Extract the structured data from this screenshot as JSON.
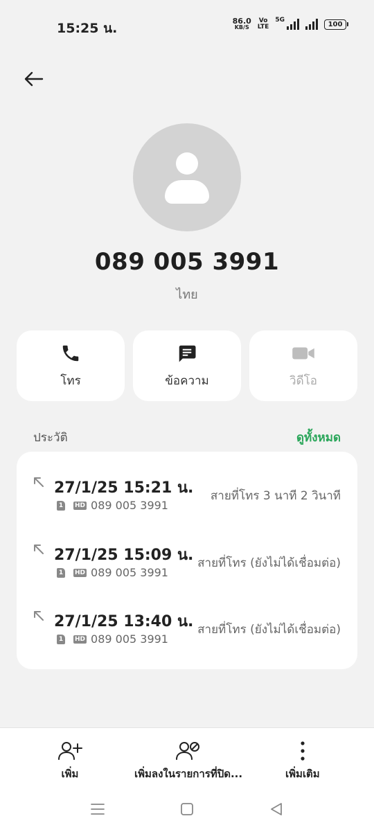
{
  "status_bar": {
    "time": "15:25 น.",
    "net_speed_value": "86.0",
    "net_speed_unit": "KB/S",
    "volte_top": "Vo",
    "volte_bottom": "LTE",
    "network_type": "5G",
    "battery": "100",
    "icons": [
      "signal-bars-icon",
      "signal-bars-icon",
      "battery-icon"
    ]
  },
  "header": {
    "back_icon": "arrow-left-icon"
  },
  "contact": {
    "avatar_icon": "person-icon",
    "number": "089 005 3991",
    "region": "ไทย"
  },
  "actions": [
    {
      "label": "โทร",
      "icon": "phone-icon",
      "enabled": true
    },
    {
      "label": "ข้อความ",
      "icon": "message-icon",
      "enabled": true
    },
    {
      "label": "วิดีโอ",
      "icon": "video-camera-icon",
      "enabled": false
    }
  ],
  "history": {
    "title": "ประวัติ",
    "view_all": "ดูทั้งหมด",
    "calls": [
      {
        "datetime": "27/1/25 15:21 น.",
        "sim": "1",
        "hd": "HD",
        "number": "089 005 3991",
        "status": "สายที่โทร  3 นาที 2 วินาที",
        "icon": "outgoing-call-icon"
      },
      {
        "datetime": "27/1/25 15:09 น.",
        "sim": "1",
        "hd": "HD",
        "number": "089 005 3991",
        "status": "สายที่โทร (ยังไม่ได้เชื่อมต่อ)",
        "icon": "outgoing-call-icon"
      },
      {
        "datetime": "27/1/25 13:40 น.",
        "sim": "1",
        "hd": "HD",
        "number": "089 005 3991",
        "status": "สายที่โทร (ยังไม่ได้เชื่อมต่อ)",
        "icon": "outgoing-call-icon"
      }
    ]
  },
  "bottom_actions": [
    {
      "label": "เพิ่ม",
      "icon": "add-person-icon"
    },
    {
      "label": "เพิ่มลงในรายการที่ปิด...",
      "icon": "block-person-icon"
    },
    {
      "label": "เพิ่มเติม",
      "icon": "more-vertical-icon"
    }
  ],
  "nav": {
    "icons": [
      "menu-icon",
      "home-icon",
      "back-icon"
    ]
  },
  "colors": {
    "accent": "#2aa65a",
    "background": "#f2f2f2",
    "card": "#ffffff",
    "avatar": "#d3d3d3"
  }
}
